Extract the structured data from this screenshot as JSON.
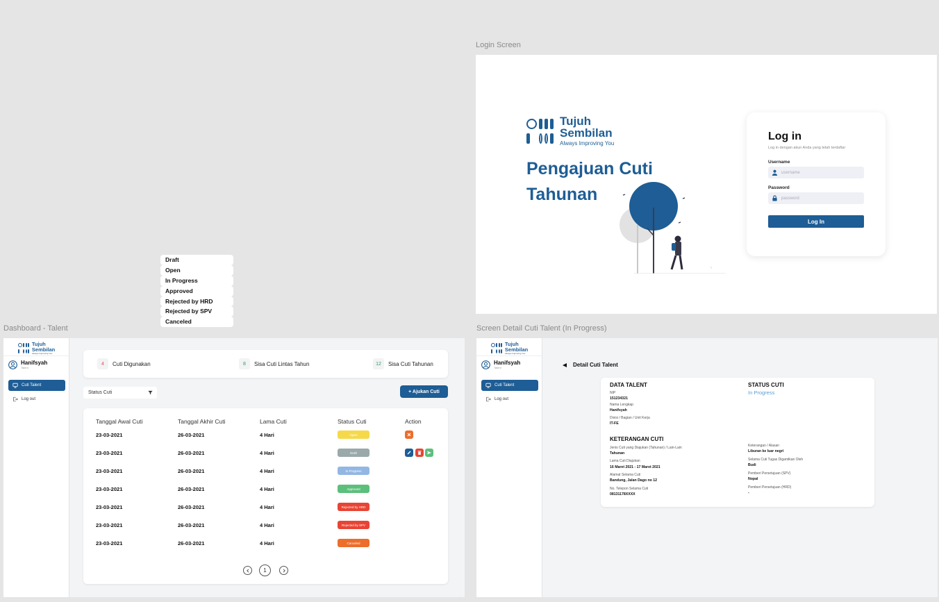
{
  "frames": {
    "login": "Login Screen",
    "dashboard": "Dashboard - Talent",
    "detail": "Screen Detail Cuti Talent (In Progress)"
  },
  "brand": {
    "line1": "Tujuh",
    "line2": "Sembilan",
    "tagline": "Always Improving You",
    "color": "#1e5d95"
  },
  "login": {
    "title": "Pengajuan Cuti Tahunan",
    "heading": "Log in",
    "subheading": "Log in dengan akun Anda yang telah terdaftar",
    "username_label": "Username",
    "username_placeholder": "username",
    "password_label": "Password",
    "password_placeholder": "password",
    "button": "Log In"
  },
  "dropdown": {
    "options": [
      "Draft",
      "Open",
      "In Progress",
      "Approved",
      "Rejected by HRD",
      "Rejected by SPV",
      "Canceled"
    ]
  },
  "sidebar": {
    "user_name": "Hanifsyah",
    "user_role": "Talent",
    "nav_active": "Cuti Talent",
    "logout": "Log out"
  },
  "dashboard": {
    "stats": [
      {
        "value": "4",
        "label": "Cuti Digunakan",
        "color": "#e74c3c"
      },
      {
        "value": "8",
        "label": "Sisa Cuti Lintas Tahun",
        "color": "#2e9c5e"
      },
      {
        "value": "12",
        "label": "Sisa Cuti Tahunan",
        "color": "#2e9c5e"
      }
    ],
    "filter_label": "Status Cuti",
    "add_button": "+ Ajukan Cuti",
    "columns": [
      "Tanggal Awal Cuti",
      "Tanggal Akhir Cuti",
      "Lama Cuti",
      "Status Cuti",
      "Action"
    ],
    "rows": [
      {
        "start": "23-03-2021",
        "end": "26-03-2021",
        "duration": "4 Hari",
        "status": "Open",
        "status_color": "#f5d94a"
      },
      {
        "start": "23-03-2021",
        "end": "26-03-2021",
        "duration": "4 Hari",
        "status": "Draft",
        "status_color": "#9aa9aa"
      },
      {
        "start": "23-03-2021",
        "end": "26-03-2021",
        "duration": "4 Hari",
        "status": "In Progress",
        "status_color": "#93b7e3"
      },
      {
        "start": "23-03-2021",
        "end": "26-03-2021",
        "duration": "4 Hari",
        "status": "Approved",
        "status_color": "#5cbf7c"
      },
      {
        "start": "23-03-2021",
        "end": "26-03-2021",
        "duration": "4 Hari",
        "status": "Rejected by HRD",
        "status_color": "#e84434"
      },
      {
        "start": "23-03-2021",
        "end": "26-03-2021",
        "duration": "4 Hari",
        "status": "Rejected by SPV",
        "status_color": "#e84434"
      },
      {
        "start": "23-03-2021",
        "end": "26-03-2021",
        "duration": "4 Hari",
        "status": "Canceled",
        "status_color": "#ec6d2c"
      }
    ],
    "page_current": "1"
  },
  "detail": {
    "back_label": "Detail Cuti Talent",
    "data_talent_title": "DATA TALENT",
    "nip_label": "NIP",
    "nip": "151234321",
    "name_label": "Nama Lengkap",
    "name": "Hanifsyah",
    "division_label": "Divisi / Bagian / Unit Kerja",
    "division": "IT-FE",
    "status_title": "STATUS CUTI",
    "status": "In Progress",
    "keterangan_title": "KETERANGAN CUTI",
    "jenis_label": "Jenis Cuti yang Diajukan (Tahunan) / Lain-Lain",
    "jenis": "Tahunan",
    "lama_label": "Lama Cuti Diajukan",
    "lama": "16 Maret 2021 - 17 Maret 2021",
    "alamat_label": "Alamat Selama Cuti",
    "alamat": "Bandung, Jalan Dago no 12",
    "telp_label": "No. Telepon Selama Cuti",
    "telp": "08131178XXXX",
    "alasan_label": "Keterangan / Alasan",
    "alasan": "Liburan ke luar negri",
    "pengganti_label": "Selama Cuti Tugas Digantikan Oleh",
    "pengganti": "Budi",
    "spv_label": "Pemberi Persetujuan (SPV)",
    "spv": "Nopal",
    "hrd_label": "Pemberi Persetujuan (HRD)",
    "hrd": "-"
  }
}
